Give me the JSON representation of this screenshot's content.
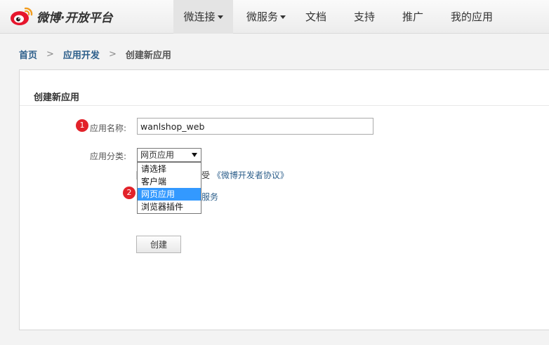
{
  "header": {
    "logo_text": "微博·开放平台",
    "nav": [
      {
        "label": "微连接",
        "dropdown": true,
        "active": true
      },
      {
        "label": "微服务",
        "dropdown": true,
        "active": false
      },
      {
        "label": "文档",
        "dropdown": false,
        "active": false
      },
      {
        "label": "支持",
        "dropdown": false,
        "active": false
      },
      {
        "label": "推广",
        "dropdown": false,
        "active": false
      },
      {
        "label": "我的应用",
        "dropdown": false,
        "active": false
      }
    ]
  },
  "breadcrumb": {
    "home": "首页",
    "sep": ">",
    "section": "应用开发",
    "current": "创建新应用"
  },
  "form": {
    "title": "创建新应用",
    "name_label": "应用名称:",
    "name_value": "wanlshop_web",
    "category_label": "应用分类:",
    "category_selected": "网页应用",
    "category_options": [
      "请选择",
      "客户端",
      "网页应用",
      "浏览器插件"
    ],
    "selected_index": 2,
    "agree_prefix": "受",
    "agree_link": "《微博开发者协议》",
    "service_partial": "服务",
    "create_button": "创建"
  },
  "annotations": {
    "badge_1": "1",
    "badge_2": "2",
    "color": "#e2222a"
  },
  "colors": {
    "link": "#2d5f8b",
    "selected_option": "#3399ff"
  }
}
